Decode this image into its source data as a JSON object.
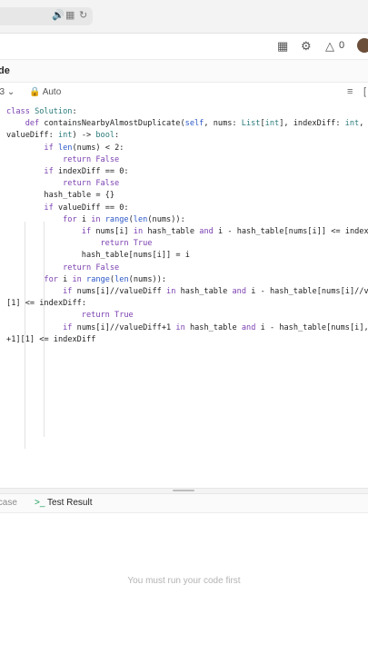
{
  "browser": {
    "icons": [
      "speaker-icon",
      "translate-icon",
      "reload-icon"
    ]
  },
  "header": {
    "icons": [
      "layout-icon",
      "settings-icon",
      "fire-icon"
    ],
    "fire_count": "0"
  },
  "editor": {
    "tab_label": "de",
    "language": "n3",
    "mode": "Auto",
    "code_lines": [
      "class Solution:",
      "    def containsNearbyAlmostDuplicate(self, nums: List[int], indexDiff: int,",
      "valueDiff: int) -> bool:",
      "        if len(nums) < 2:",
      "            return False",
      "        if indexDiff == 0:",
      "            return False",
      "        hash_table = {}",
      "        if valueDiff == 0:",
      "            for i in range(len(nums)):",
      "                if nums[i] in hash_table and i - hash_table[nums[i]] <= index",
      "                    return True",
      "                hash_table[nums[i]] = i",
      "            return False",
      "        for i in range(len(nums)):",
      "            if nums[i]//valueDiff in hash_table and i - hash_table[nums[i]//v",
      "[1] <= indexDiff:",
      "                return True",
      "            if nums[i]//valueDiff+1 in hash_table and i - hash_table[nums[i],",
      "+1][1] <= indexDiff"
    ]
  },
  "results": {
    "tab_testcase": "stcase",
    "tab_result": "Test Result",
    "message": "You must run your code first"
  }
}
